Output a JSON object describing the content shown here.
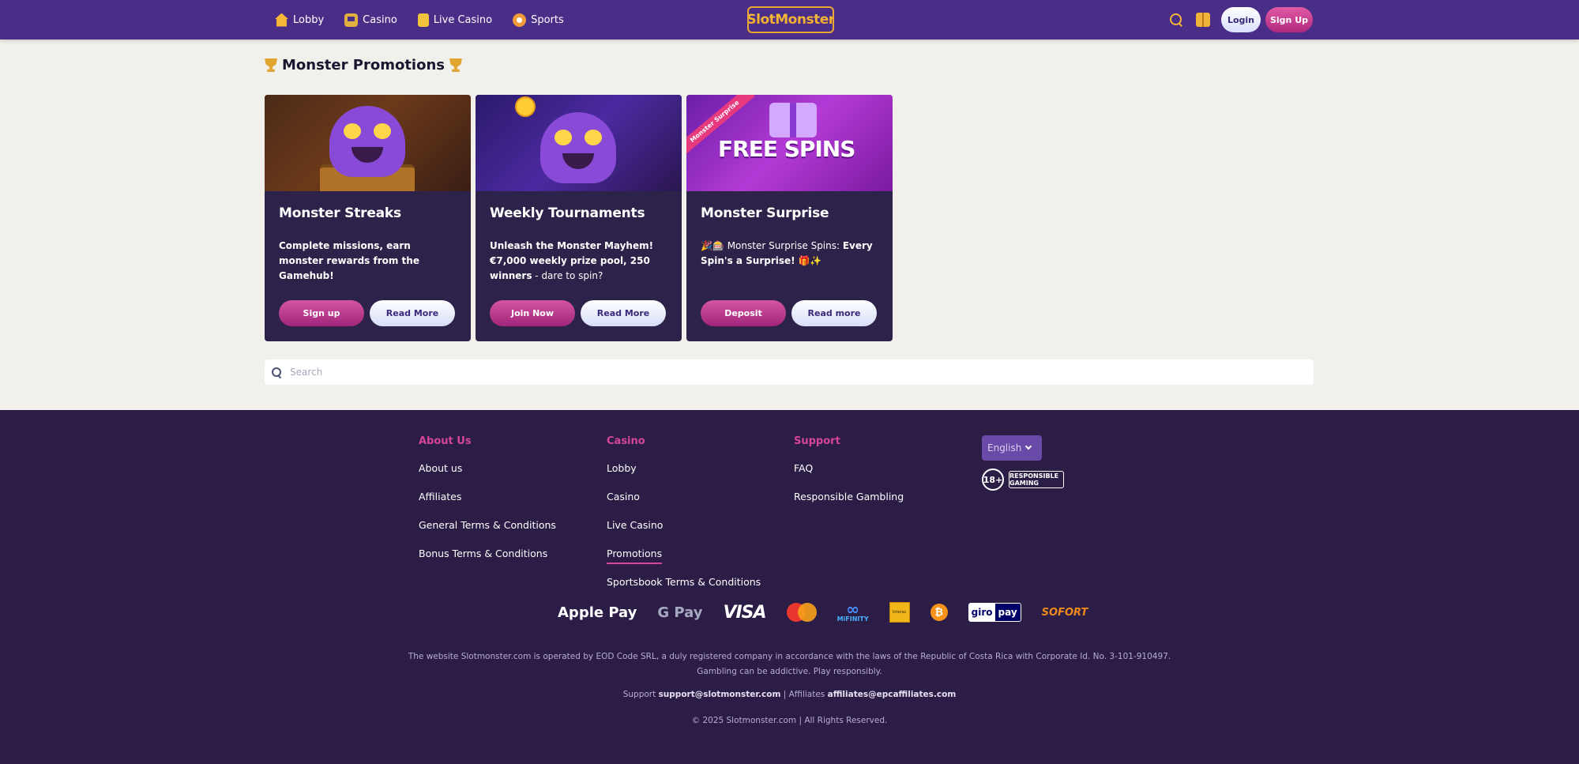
{
  "header": {
    "nav": [
      {
        "label": "Lobby",
        "icon": "home-icon"
      },
      {
        "label": "Casino",
        "icon": "slot-machine-icon"
      },
      {
        "label": "Live Casino",
        "icon": "cards-icon"
      },
      {
        "label": "Sports",
        "icon": "ball-icon"
      }
    ],
    "logo_text": "SlotMonster",
    "login_label": "Login",
    "signup_label": "Sign Up"
  },
  "main": {
    "title": "Monster Promotions",
    "promotions": [
      {
        "title": "Monster Streaks",
        "description_bold": "Complete missions, earn monster rewards from the Gamehub!",
        "description_rest": "",
        "primary_label": "Sign up",
        "secondary_label": "Read More"
      },
      {
        "title": "Weekly Tournaments",
        "description_bold": "Unleash the Monster Mayhem! €7,000 weekly prize pool, 250 winners",
        "description_rest": " - dare to spin?",
        "primary_label": "Join Now",
        "secondary_label": "Read More"
      },
      {
        "title": "Monster Surprise",
        "description_prefix": "🎉🎰 Monster Surprise Spins: ",
        "description_bold": "Every Spin's a Surprise!",
        "description_rest": " 🎁✨",
        "primary_label": "Deposit",
        "secondary_label": "Read more",
        "image_text": "FREE SPINS",
        "ribbon_text": "Monster Surprise"
      }
    ],
    "search_placeholder": "Search"
  },
  "footer": {
    "columns": [
      {
        "heading": "About Us",
        "links": [
          "About us",
          "Affiliates",
          "General Terms & Conditions",
          "Bonus Terms & Conditions"
        ]
      },
      {
        "heading": "Casino",
        "links": [
          "Lobby",
          "Casino",
          "Live Casino",
          "Promotions",
          "Sportsbook Terms & Conditions"
        ],
        "active": "Promotions"
      },
      {
        "heading": "Support",
        "links": [
          "FAQ",
          "Responsible Gambling"
        ]
      }
    ],
    "language": "English",
    "badge_age": "18+",
    "badge_rg": "RESPONSIBLE GAMING",
    "payments": [
      "Apple Pay",
      "G Pay",
      "VISA",
      "Mastercard",
      "MiFINITY",
      "Interac",
      "Bitcoin",
      "giropay",
      "SOFORT"
    ],
    "legal_line1": "The website Slotmonster.com is operated by EOD Code SRL, a duly registered company in accordance with the laws of the Republic of Costa Rica with Corporate Id. No. 3-101-910497.",
    "legal_line2": "Gambling can be addictive. Play responsibly.",
    "support_label": "Support",
    "support_email": "support@slotmonster.com",
    "affiliates_label": "| Affiliates",
    "affiliates_email": "affiliates@epcaffiliates.com",
    "copyright": "© 2025 Slotmonster.com | All Rights Reserved."
  },
  "colors": {
    "header_bg": "#4a2d86",
    "page_bg": "#f1f0ea",
    "card_bg": "#2d2249",
    "footer_bg": "#2b1d46",
    "accent_pink": "#d6459a"
  }
}
